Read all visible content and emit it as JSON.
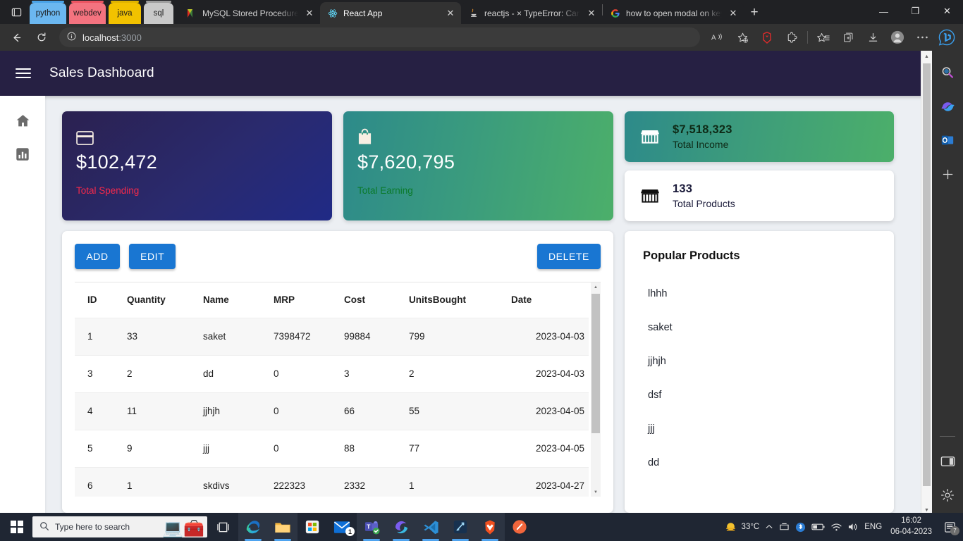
{
  "browser": {
    "pinned_tabs": [
      {
        "label": "python",
        "bg": "#6bb7f0",
        "bar": "#4aa3e8"
      },
      {
        "label": "webdev",
        "bg": "#f4737f",
        "bar": "#ec5562"
      },
      {
        "label": "java",
        "bg": "#f2c200",
        "bar": "#e0b400"
      },
      {
        "label": "sql",
        "bg": "#c9c9c9",
        "bar": "#9e9e9e"
      }
    ],
    "tabs": [
      {
        "title": "MySQL Stored Procedure Para",
        "icon": "mysql-icon",
        "active": false
      },
      {
        "title": "React App",
        "icon": "react-icon",
        "active": true
      },
      {
        "title": "reactjs - × TypeError: Cannot r",
        "icon": "java-icon",
        "active": false
      },
      {
        "title": "how to open modal on key pr",
        "icon": "google-icon",
        "active": false
      }
    ],
    "new_tab_label": "+",
    "close_label": "✕",
    "window_controls": {
      "minimize": "—",
      "maximize": "❐",
      "close": "✕"
    },
    "address": {
      "host": "localhost",
      "port": ":3000"
    },
    "toolbar_icons": [
      "back-icon",
      "refresh-icon",
      "info-icon",
      "read-aloud-icon",
      "add-favorite-icon",
      "brave-icon",
      "extensions-icon",
      "favorites-icon",
      "collections-icon",
      "downloads-icon",
      "profile-icon",
      "settings-more-icon",
      "bing-copilot-icon"
    ]
  },
  "app": {
    "title": "Sales Dashboard",
    "sidebar": [
      {
        "icon": "home-icon",
        "name": "sidebar-item-home"
      },
      {
        "icon": "chart-icon",
        "name": "sidebar-item-analytics"
      }
    ]
  },
  "stats": {
    "spending": {
      "value": "$102,472",
      "label": "Total Spending",
      "icon": "credit-card-icon"
    },
    "earning": {
      "value": "$7,620,795",
      "label": "Total Earning",
      "icon": "shopping-bag-icon"
    },
    "income": {
      "value": "$7,518,323",
      "label": "Total Income",
      "icon": "store-icon"
    },
    "products": {
      "value": "133",
      "label": "Total Products",
      "icon": "store-icon"
    }
  },
  "table_panel": {
    "buttons": {
      "add": "ADD",
      "edit": "EDIT",
      "delete": "DELETE"
    },
    "columns": [
      "ID",
      "Quantity",
      "Name",
      "MRP",
      "Cost",
      "UnitsBought",
      "Date"
    ],
    "rows": [
      {
        "id": "1",
        "quantity": "33",
        "name": "saket",
        "mrp": "7398472",
        "cost": "99884",
        "units_bought": "799",
        "date": "2023-04-03"
      },
      {
        "id": "3",
        "quantity": "2",
        "name": "dd",
        "mrp": "0",
        "cost": "3",
        "units_bought": "2",
        "date": "2023-04-03"
      },
      {
        "id": "4",
        "quantity": "11",
        "name": "jjhjh",
        "mrp": "0",
        "cost": "66",
        "units_bought": "55",
        "date": "2023-04-05"
      },
      {
        "id": "5",
        "quantity": "9",
        "name": "jjj",
        "mrp": "0",
        "cost": "88",
        "units_bought": "77",
        "date": "2023-04-05"
      },
      {
        "id": "6",
        "quantity": "1",
        "name": "skdivs",
        "mrp": "222323",
        "cost": "2332",
        "units_bought": "1",
        "date": "2023-04-27"
      }
    ]
  },
  "popular_products": {
    "title": "Popular Products",
    "items": [
      "lhhh",
      "saket",
      "jjhjh",
      "dsf",
      "jjj",
      "dd"
    ]
  },
  "edge_sidebar": [
    "search-icon",
    "copilot-icon",
    "outlook-icon",
    "add-tool-icon",
    "split-screen-icon",
    "gear-icon"
  ],
  "taskbar": {
    "search_placeholder": "Type here to search",
    "apps": [
      "edge-icon",
      "file-explorer-icon",
      "microsoft-store-icon",
      "mail-icon",
      "teams-icon",
      "edge-dev-icon",
      "vscode-icon",
      "editor-icon",
      "brave-icon",
      "postman-icon"
    ],
    "mail_badge": "1",
    "weather": {
      "temp": "33°C",
      "icon": "sun-icon"
    },
    "language": "ENG",
    "time": "16:02",
    "date": "06-04-2023",
    "notification_count": "7"
  },
  "colors": {
    "appbar": "#262043",
    "accent_blue": "#1976d2",
    "spending_label": "#f5294b",
    "earning_label": "#0a7a2a",
    "page_bg": "#eceff3"
  }
}
